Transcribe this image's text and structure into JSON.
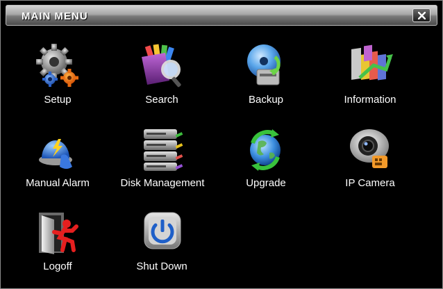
{
  "window": {
    "title": "MAIN MENU"
  },
  "menu": {
    "setup": "Setup",
    "search": "Search",
    "backup": "Backup",
    "information": "Information",
    "manual_alarm": "Manual Alarm",
    "disk_management": "Disk Management",
    "upgrade": "Upgrade",
    "ip_camera": "IP Camera",
    "logoff": "Logoff",
    "shut_down": "Shut Down"
  },
  "colors": {
    "background": "#000000",
    "titlebar_top": "#d4d4d4",
    "titlebar_bottom": "#4b4b4b",
    "text": "#ffffff"
  },
  "icons": [
    "gears-icon",
    "folder-search-icon",
    "disc-backup-icon",
    "bar-chart-icon",
    "alarm-light-icon",
    "disk-stack-icon",
    "globe-refresh-icon",
    "camera-icon",
    "exit-door-icon",
    "power-icon"
  ]
}
